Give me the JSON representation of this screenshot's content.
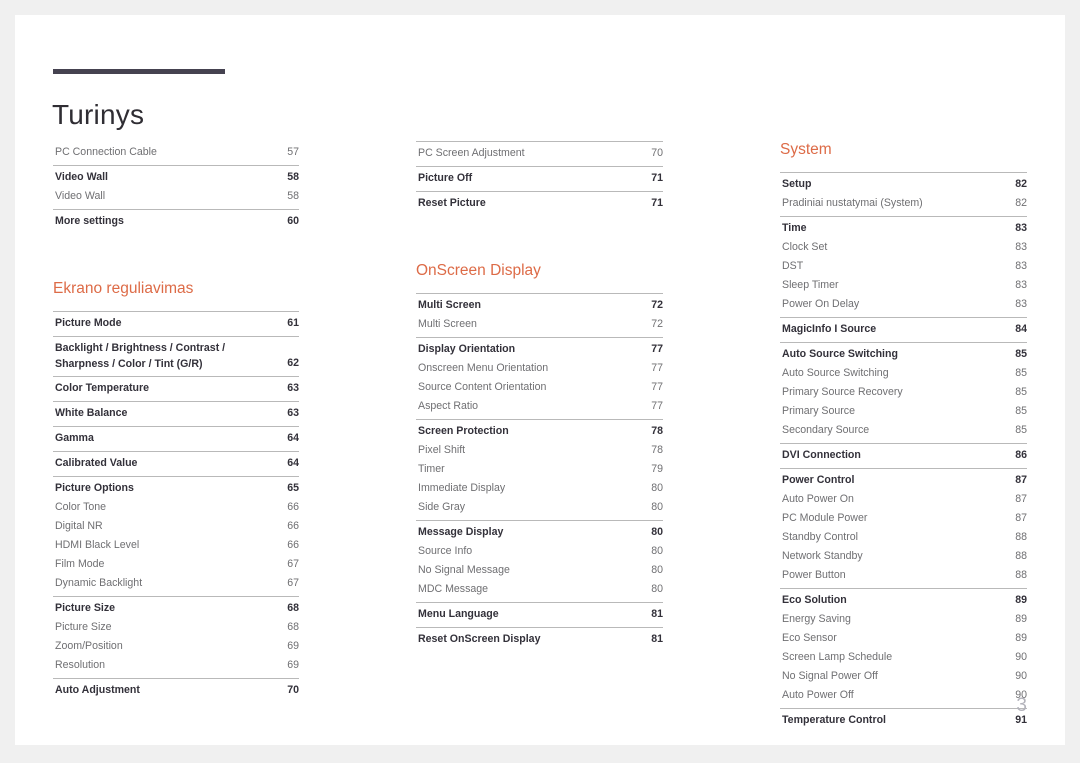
{
  "document": {
    "title": "Turinys",
    "page_number": "3",
    "accent_color": "#dd6b47",
    "rule_color": "#454250"
  },
  "columns": [
    {
      "id": "column-1",
      "blocks": [
        {
          "type": "group",
          "rule": false,
          "entries": [
            {
              "label": "PC Connection Cable",
              "page": "57",
              "level": "child"
            }
          ]
        },
        {
          "type": "group",
          "rule": true,
          "entries": [
            {
              "label": "Video Wall",
              "page": "58",
              "level": "parent"
            },
            {
              "label": "Video Wall",
              "page": "58",
              "level": "child"
            }
          ]
        },
        {
          "type": "group",
          "rule": true,
          "entries": [
            {
              "label": "More settings",
              "page": "60",
              "level": "parent"
            }
          ]
        },
        {
          "type": "spacer",
          "size": "lg"
        },
        {
          "type": "section",
          "label": "Ekrano reguliavimas"
        },
        {
          "type": "group",
          "rule": true,
          "entries": [
            {
              "label": "Picture Mode",
              "page": "61",
              "level": "parent"
            }
          ]
        },
        {
          "type": "group",
          "rule": true,
          "entries": [
            {
              "label": "Backlight / Brightness / Contrast / Sharpness / Color / Tint (G/R)",
              "page": "62",
              "level": "parent",
              "twoline": true
            }
          ]
        },
        {
          "type": "group",
          "rule": true,
          "entries": [
            {
              "label": "Color Temperature",
              "page": "63",
              "level": "parent"
            }
          ]
        },
        {
          "type": "group",
          "rule": true,
          "entries": [
            {
              "label": "White Balance",
              "page": "63",
              "level": "parent"
            }
          ]
        },
        {
          "type": "group",
          "rule": true,
          "entries": [
            {
              "label": "Gamma",
              "page": "64",
              "level": "parent"
            }
          ]
        },
        {
          "type": "group",
          "rule": true,
          "entries": [
            {
              "label": "Calibrated Value",
              "page": "64",
              "level": "parent"
            }
          ]
        },
        {
          "type": "group",
          "rule": true,
          "entries": [
            {
              "label": "Picture Options",
              "page": "65",
              "level": "parent"
            },
            {
              "label": "Color Tone",
              "page": "66",
              "level": "child"
            },
            {
              "label": "Digital NR",
              "page": "66",
              "level": "child"
            },
            {
              "label": "HDMI Black Level",
              "page": "66",
              "level": "child"
            },
            {
              "label": "Film Mode",
              "page": "67",
              "level": "child"
            },
            {
              "label": "Dynamic Backlight",
              "page": "67",
              "level": "child"
            }
          ]
        },
        {
          "type": "group",
          "rule": true,
          "entries": [
            {
              "label": "Picture Size",
              "page": "68",
              "level": "parent"
            },
            {
              "label": "Picture Size",
              "page": "68",
              "level": "child"
            },
            {
              "label": "Zoom/Position",
              "page": "69",
              "level": "child"
            },
            {
              "label": "Resolution",
              "page": "69",
              "level": "child"
            }
          ]
        },
        {
          "type": "group",
          "rule": true,
          "entries": [
            {
              "label": "Auto Adjustment",
              "page": "70",
              "level": "parent"
            }
          ]
        }
      ]
    },
    {
      "id": "column-2",
      "blocks": [
        {
          "type": "group",
          "rule": true,
          "entries": [
            {
              "label": "PC Screen Adjustment",
              "page": "70",
              "level": "child"
            }
          ]
        },
        {
          "type": "group",
          "rule": true,
          "entries": [
            {
              "label": "Picture Off",
              "page": "71",
              "level": "parent"
            }
          ]
        },
        {
          "type": "group",
          "rule": true,
          "entries": [
            {
              "label": "Reset Picture",
              "page": "71",
              "level": "parent"
            }
          ]
        },
        {
          "type": "spacer",
          "size": "lg"
        },
        {
          "type": "section",
          "label": "OnScreen Display"
        },
        {
          "type": "group",
          "rule": true,
          "entries": [
            {
              "label": "Multi Screen",
              "page": "72",
              "level": "parent"
            },
            {
              "label": "Multi Screen",
              "page": "72",
              "level": "child"
            }
          ]
        },
        {
          "type": "group",
          "rule": true,
          "entries": [
            {
              "label": "Display Orientation",
              "page": "77",
              "level": "parent"
            },
            {
              "label": "Onscreen Menu Orientation",
              "page": "77",
              "level": "child"
            },
            {
              "label": "Source Content Orientation",
              "page": "77",
              "level": "child"
            },
            {
              "label": "Aspect Ratio",
              "page": "77",
              "level": "child"
            }
          ]
        },
        {
          "type": "group",
          "rule": true,
          "entries": [
            {
              "label": "Screen Protection",
              "page": "78",
              "level": "parent"
            },
            {
              "label": "Pixel Shift",
              "page": "78",
              "level": "child"
            },
            {
              "label": "Timer",
              "page": "79",
              "level": "child"
            },
            {
              "label": "Immediate Display",
              "page": "80",
              "level": "child"
            },
            {
              "label": "Side Gray",
              "page": "80",
              "level": "child"
            }
          ]
        },
        {
          "type": "group",
          "rule": true,
          "entries": [
            {
              "label": "Message Display",
              "page": "80",
              "level": "parent"
            },
            {
              "label": "Source Info",
              "page": "80",
              "level": "child"
            },
            {
              "label": "No Signal Message",
              "page": "80",
              "level": "child"
            },
            {
              "label": "MDC Message",
              "page": "80",
              "level": "child"
            }
          ]
        },
        {
          "type": "group",
          "rule": true,
          "entries": [
            {
              "label": "Menu Language",
              "page": "81",
              "level": "parent"
            }
          ]
        },
        {
          "type": "group",
          "rule": true,
          "entries": [
            {
              "label": "Reset OnScreen Display",
              "page": "81",
              "level": "parent"
            }
          ]
        }
      ]
    },
    {
      "id": "column-3",
      "blocks": [
        {
          "type": "section",
          "label": "System",
          "first": true
        },
        {
          "type": "group",
          "rule": true,
          "entries": [
            {
              "label": "Setup",
              "page": "82",
              "level": "parent"
            },
            {
              "label": "Pradiniai nustatymai (System)",
              "page": "82",
              "level": "child"
            }
          ]
        },
        {
          "type": "group",
          "rule": true,
          "entries": [
            {
              "label": "Time",
              "page": "83",
              "level": "parent"
            },
            {
              "label": "Clock Set",
              "page": "83",
              "level": "child"
            },
            {
              "label": "DST",
              "page": "83",
              "level": "child"
            },
            {
              "label": "Sleep Timer",
              "page": "83",
              "level": "child"
            },
            {
              "label": "Power On Delay",
              "page": "83",
              "level": "child"
            }
          ]
        },
        {
          "type": "group",
          "rule": true,
          "entries": [
            {
              "label": "MagicInfo I Source",
              "page": "84",
              "level": "parent"
            }
          ]
        },
        {
          "type": "group",
          "rule": true,
          "entries": [
            {
              "label": "Auto Source Switching",
              "page": "85",
              "level": "parent"
            },
            {
              "label": "Auto Source Switching",
              "page": "85",
              "level": "child"
            },
            {
              "label": "Primary Source Recovery",
              "page": "85",
              "level": "child"
            },
            {
              "label": "Primary Source",
              "page": "85",
              "level": "child"
            },
            {
              "label": "Secondary Source",
              "page": "85",
              "level": "child"
            }
          ]
        },
        {
          "type": "group",
          "rule": true,
          "entries": [
            {
              "label": "DVI Connection",
              "page": "86",
              "level": "parent"
            }
          ]
        },
        {
          "type": "group",
          "rule": true,
          "entries": [
            {
              "label": "Power Control",
              "page": "87",
              "level": "parent"
            },
            {
              "label": "Auto Power On",
              "page": "87",
              "level": "child"
            },
            {
              "label": "PC Module Power",
              "page": "87",
              "level": "child"
            },
            {
              "label": "Standby Control",
              "page": "88",
              "level": "child"
            },
            {
              "label": "Network Standby",
              "page": "88",
              "level": "child"
            },
            {
              "label": "Power Button",
              "page": "88",
              "level": "child"
            }
          ]
        },
        {
          "type": "group",
          "rule": true,
          "entries": [
            {
              "label": "Eco Solution",
              "page": "89",
              "level": "parent"
            },
            {
              "label": "Energy Saving",
              "page": "89",
              "level": "child"
            },
            {
              "label": "Eco Sensor",
              "page": "89",
              "level": "child"
            },
            {
              "label": "Screen Lamp Schedule",
              "page": "90",
              "level": "child"
            },
            {
              "label": "No Signal Power Off",
              "page": "90",
              "level": "child"
            },
            {
              "label": "Auto Power Off",
              "page": "90",
              "level": "child"
            }
          ]
        },
        {
          "type": "group",
          "rule": true,
          "entries": [
            {
              "label": "Temperature Control",
              "page": "91",
              "level": "parent"
            }
          ]
        }
      ]
    }
  ]
}
